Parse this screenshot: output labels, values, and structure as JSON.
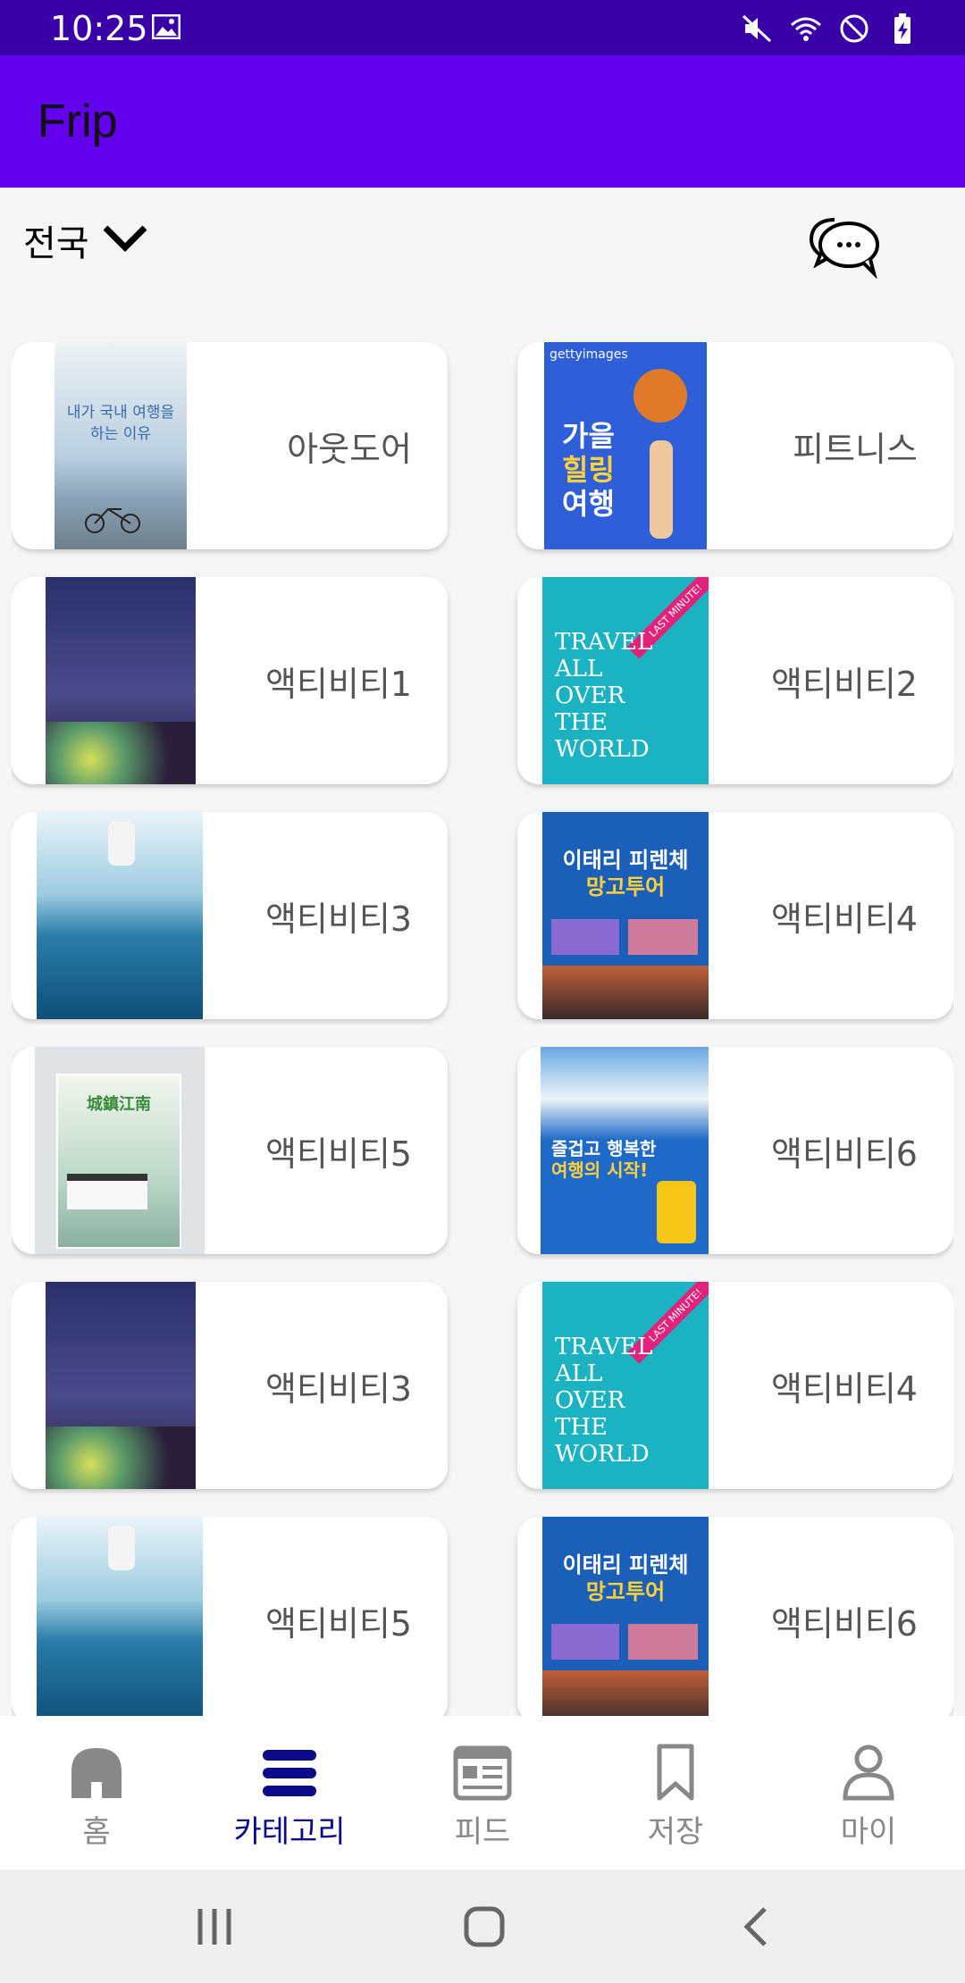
{
  "status": {
    "time": "10:25"
  },
  "app": {
    "title": "Frip"
  },
  "filter": {
    "region": "전국"
  },
  "categories": [
    {
      "label": "아웃도어",
      "icon": "poster-domestic-travel"
    },
    {
      "label": "피트니스",
      "icon": "poster-autumn-healing-travel"
    },
    {
      "label": "액티비티1",
      "icon": "poster-night-sky"
    },
    {
      "label": "액티비티2",
      "icon": "poster-travel-all-over-the-world"
    },
    {
      "label": "액티비티3",
      "icon": "poster-sea-skyline"
    },
    {
      "label": "액티비티4",
      "icon": "poster-italy-florence-tour"
    },
    {
      "label": "액티비티5",
      "icon": "poster-jiangnan-town"
    },
    {
      "label": "액티비티6",
      "icon": "poster-santorini-happy-trip"
    },
    {
      "label": "액티비티3",
      "icon": "poster-night-sky"
    },
    {
      "label": "액티비티4",
      "icon": "poster-travel-all-over-the-world"
    },
    {
      "label": "액티비티5",
      "icon": "poster-sea-skyline"
    },
    {
      "label": "액티비티6",
      "icon": "poster-italy-florence-tour"
    }
  ],
  "posters": {
    "domestic_line1": "내가 국내 여행을",
    "domestic_line2": "하는 이유",
    "autumn_line1": "가을",
    "autumn_line2": "힐링",
    "autumn_line3": "여행",
    "getty": "gettyimages",
    "travel_lines": [
      "TRAVEL",
      "ALL",
      "OVER",
      "THE",
      "WORLD"
    ],
    "last_minute": "LAST MINUTE!",
    "italy_line1": "이태리 피렌체",
    "italy_line2": "망고투어",
    "jiangnan": "城鎮江南",
    "santorini_line1": "즐겁고 행복한",
    "santorini_line2": "여행의 시작!"
  },
  "nav": [
    {
      "label": "홈",
      "icon": "home-icon",
      "active": false
    },
    {
      "label": "카테고리",
      "icon": "menu-icon",
      "active": true
    },
    {
      "label": "피드",
      "icon": "feed-icon",
      "active": false
    },
    {
      "label": "저장",
      "icon": "bookmark-icon",
      "active": false
    },
    {
      "label": "마이",
      "icon": "person-icon",
      "active": false
    }
  ],
  "colors": {
    "status_bar": "#3a00a8",
    "app_bar": "#6200ee",
    "nav_active": "#0a0a8a",
    "nav_inactive": "#888888"
  }
}
